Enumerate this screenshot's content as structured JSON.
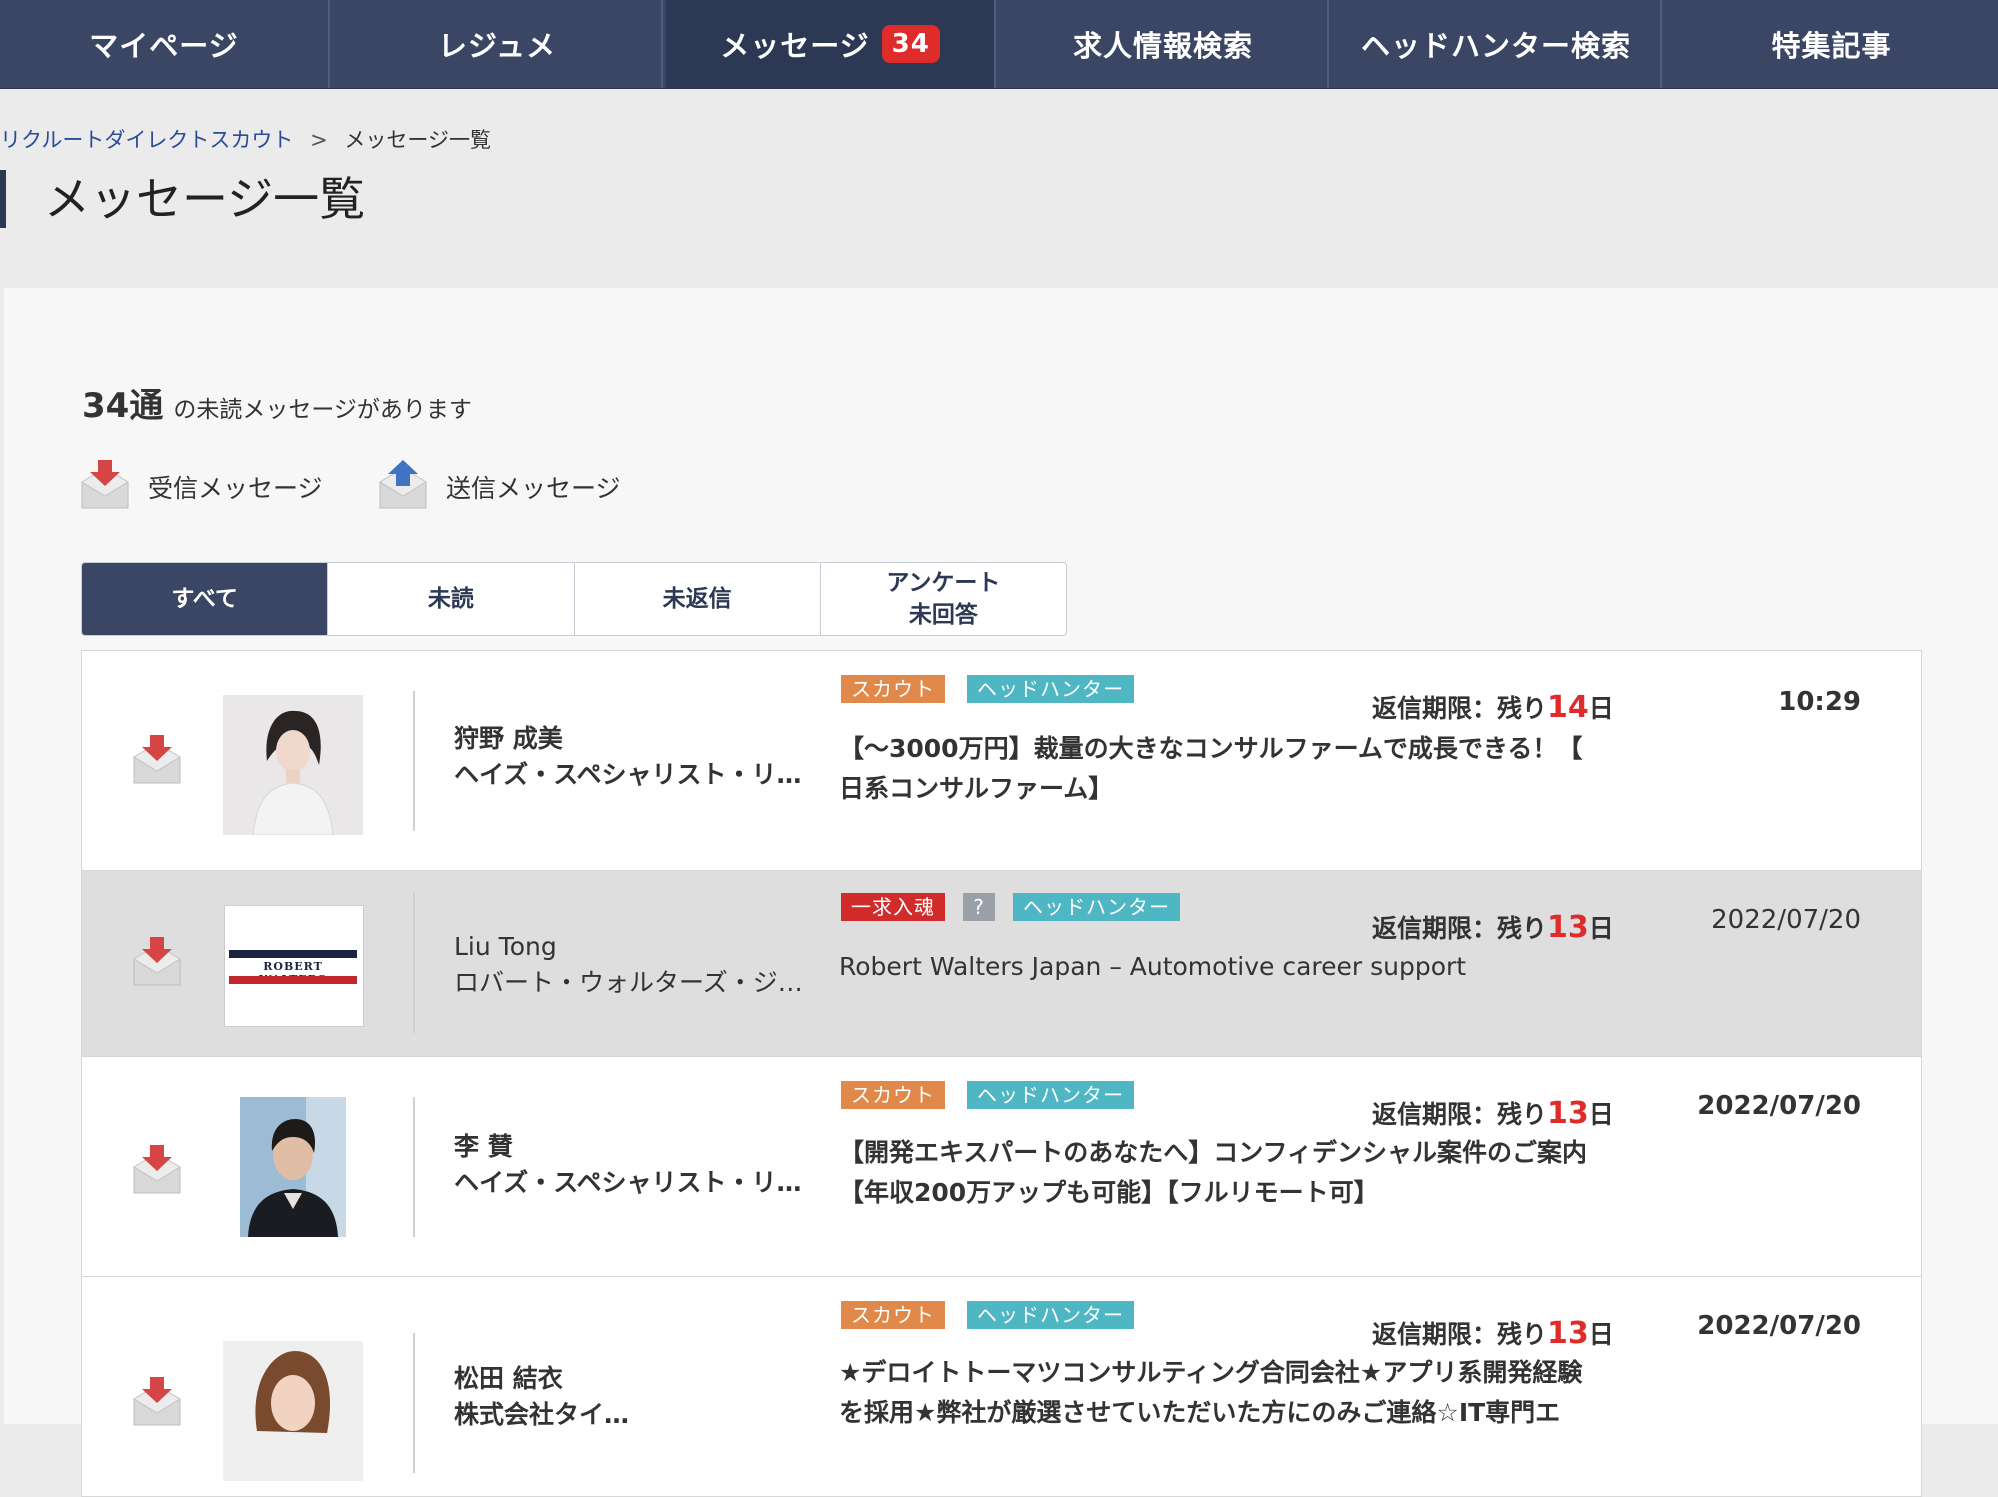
{
  "nav": {
    "items": [
      {
        "label": "マイページ"
      },
      {
        "label": "レジュメ"
      },
      {
        "label": "メッセージ",
        "badge": "34"
      },
      {
        "label": "求人情報検索"
      },
      {
        "label": "ヘッドハンター検索"
      },
      {
        "label": "特集記事"
      }
    ],
    "active_index": 2
  },
  "breadcrumb": {
    "root": "リクルートダイレクトスカウト",
    "separator": ">",
    "current": "メッセージ一覧"
  },
  "page_title": "メッセージ一覧",
  "unread": {
    "count": "34通",
    "text": "の未読メッセージがあります"
  },
  "legend": {
    "received": "受信メッセージ",
    "sent": "送信メッセージ"
  },
  "tabs": {
    "all": "すべて",
    "unread": "未読",
    "unreplied": "未返信",
    "survey_line1": "アンケート",
    "survey_line2": "未回答"
  },
  "deadline": {
    "prefix": "返信期限：残り",
    "suffix": "日"
  },
  "messages": [
    {
      "name": "狩野 成美",
      "company": "ヘイズ・スペシャリスト・リ…",
      "tags": [
        "スカウト",
        "ヘッドハンター"
      ],
      "days": "14",
      "time": "10:29",
      "subject_line1": "【〜3000万円】裁量の大きなコンサルファームで成長できる！【",
      "subject_line2": "日系コンサルファーム】"
    },
    {
      "name": "Liu Tong",
      "company": "ロバート・ウォルターズ・ジ…",
      "logo_text": "ROBERT WALTERS",
      "tags": [
        "一求入魂",
        "?",
        "ヘッドハンター"
      ],
      "days": "13",
      "time": "2022/07/20",
      "subject_line1": "Robert Walters Japan – Automotive career support"
    },
    {
      "name": "李 賛",
      "company": "ヘイズ・スペシャリスト・リ…",
      "tags": [
        "スカウト",
        "ヘッドハンター"
      ],
      "days": "13",
      "time": "2022/07/20",
      "subject_line1": "【開発エキスパートのあなたへ】コンフィデンシャル案件のご案内",
      "subject_line2": "【年収200万アップも可能】【フルリモート可】"
    },
    {
      "name": "松田 結衣",
      "company": "株式会社タイ…",
      "tags": [
        "スカウト",
        "ヘッドハンター"
      ],
      "days": "13",
      "time": "2022/07/20",
      "subject_line1": "★デロイトトーマツコンサルティング合同会社★アプリ系開発経験",
      "subject_line2": "を採用★弊社が厳選させていただいた方にのみご連絡☆IT専門エ"
    }
  ],
  "colors": {
    "nav_bg": "#3a4663",
    "badge": "#e02b2b",
    "scout_tag": "#e0894a",
    "hh_tag": "#4fb6c4",
    "req_tag": "#d12b2b",
    "days_red": "#e02b2b"
  },
  "icons": {
    "received": "mail-download-icon",
    "sent": "mail-upload-icon"
  }
}
